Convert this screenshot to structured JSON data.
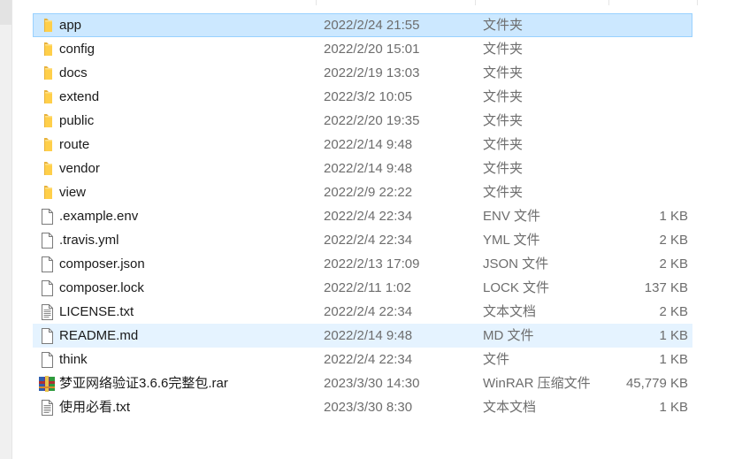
{
  "files": [
    {
      "name": "app",
      "date": "2022/2/24 21:55",
      "type": "文件夹",
      "size": "",
      "icon": "folder-icon",
      "state": "selected"
    },
    {
      "name": "config",
      "date": "2022/2/20 15:01",
      "type": "文件夹",
      "size": "",
      "icon": "folder-icon",
      "state": ""
    },
    {
      "name": "docs",
      "date": "2022/2/19 13:03",
      "type": "文件夹",
      "size": "",
      "icon": "folder-icon",
      "state": ""
    },
    {
      "name": "extend",
      "date": "2022/3/2 10:05",
      "type": "文件夹",
      "size": "",
      "icon": "folder-icon",
      "state": ""
    },
    {
      "name": "public",
      "date": "2022/2/20 19:35",
      "type": "文件夹",
      "size": "",
      "icon": "folder-icon",
      "state": ""
    },
    {
      "name": "route",
      "date": "2022/2/14 9:48",
      "type": "文件夹",
      "size": "",
      "icon": "folder-icon",
      "state": ""
    },
    {
      "name": "vendor",
      "date": "2022/2/14 9:48",
      "type": "文件夹",
      "size": "",
      "icon": "folder-icon",
      "state": ""
    },
    {
      "name": "view",
      "date": "2022/2/9 22:22",
      "type": "文件夹",
      "size": "",
      "icon": "folder-icon",
      "state": ""
    },
    {
      "name": ".example.env",
      "date": "2022/2/4 22:34",
      "type": "ENV 文件",
      "size": "1 KB",
      "icon": "file-icon",
      "state": ""
    },
    {
      "name": ".travis.yml",
      "date": "2022/2/4 22:34",
      "type": "YML 文件",
      "size": "2 KB",
      "icon": "file-icon",
      "state": ""
    },
    {
      "name": "composer.json",
      "date": "2022/2/13 17:09",
      "type": "JSON 文件",
      "size": "2 KB",
      "icon": "file-icon",
      "state": ""
    },
    {
      "name": "composer.lock",
      "date": "2022/2/11 1:02",
      "type": "LOCK 文件",
      "size": "137 KB",
      "icon": "file-icon",
      "state": ""
    },
    {
      "name": "LICENSE.txt",
      "date": "2022/2/4 22:34",
      "type": "文本文档",
      "size": "2 KB",
      "icon": "text-file-icon",
      "state": ""
    },
    {
      "name": "README.md",
      "date": "2022/2/14 9:48",
      "type": "MD 文件",
      "size": "1 KB",
      "icon": "file-icon",
      "state": "hover"
    },
    {
      "name": "think",
      "date": "2022/2/4 22:34",
      "type": "文件",
      "size": "1 KB",
      "icon": "file-icon",
      "state": ""
    },
    {
      "name": "梦亚网络验证3.6.6完整包.rar",
      "date": "2023/3/30 14:30",
      "type": "WinRAR 压缩文件",
      "size": "45,779 KB",
      "icon": "winrar-archive-icon",
      "state": ""
    },
    {
      "name": "使用必看.txt",
      "date": "2023/3/30 8:30",
      "type": "文本文档",
      "size": "1 KB",
      "icon": "text-file-icon",
      "state": ""
    }
  ],
  "colors": {
    "selected_bg": "#cce8ff",
    "selected_border": "#99d1ff",
    "hover_bg": "#e5f3ff",
    "folder": "#ffcf4a",
    "secondary_text": "#6d6d6d"
  }
}
